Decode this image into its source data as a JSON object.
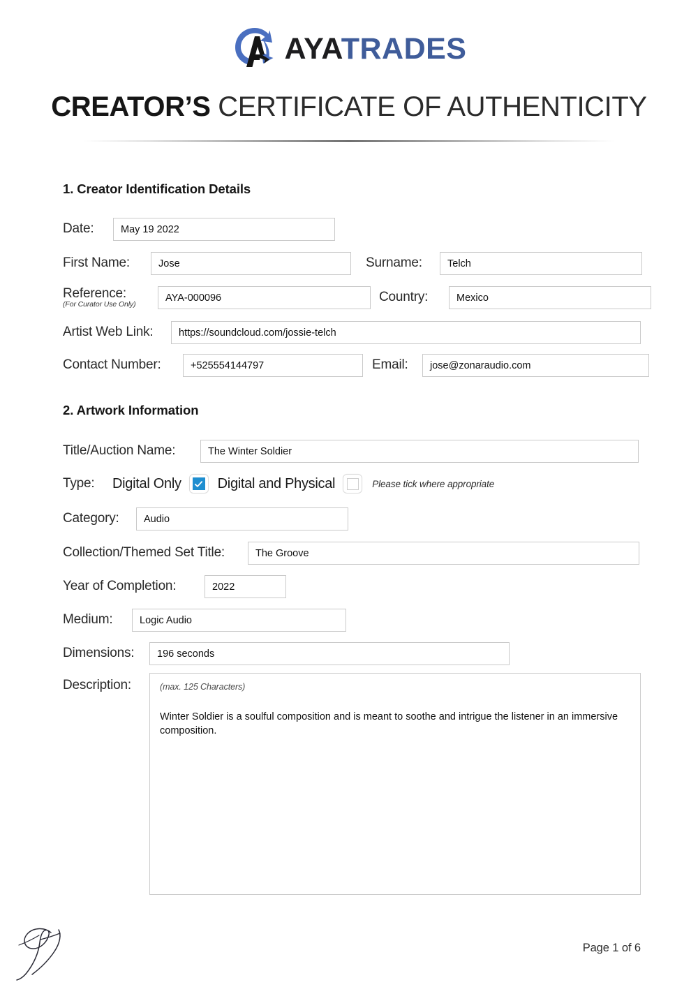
{
  "brand": {
    "logo_icon": "aya-swoosh-arrow-logo",
    "name_part1": "AYA",
    "name_part2": "TRADES",
    "blue": "#3f5c9a",
    "accent_blue": "#1e8ed0"
  },
  "document": {
    "title_strong": "CREATOR’S",
    "title_rest": "CERTIFICATE OF AUTHENTICITY"
  },
  "section1": {
    "heading": "1. Creator Identification Details",
    "date_label": "Date:",
    "date_value": "May 19 2022",
    "first_name_label": "First Name:",
    "first_name_value": "Jose",
    "surname_label": "Surname:",
    "surname_value": "Telch",
    "reference_label": "Reference:",
    "reference_sub_label": "(For Curator Use Only)",
    "reference_value": "AYA-000096",
    "country_label": "Country:",
    "country_value": "Mexico",
    "web_link_label": "Artist Web Link:",
    "web_link_value": "https://soundcloud.com/jossie-telch",
    "contact_label": "Contact Number:",
    "contact_value": "+525554144797",
    "email_label": "Email:",
    "email_value": "jose@zonaraudio.com"
  },
  "section2": {
    "heading": "2. Artwork Information",
    "title_label": "Title/Auction Name:",
    "title_value": "The Winter Soldier",
    "type_label": "Type:",
    "type_option_1": "Digital Only",
    "type_option_1_checked": true,
    "type_option_2": "Digital and Physical",
    "type_option_2_checked": false,
    "type_note": "Please tick where appropriate",
    "category_label": "Category:",
    "category_value": "Audio",
    "collection_label": "Collection/Themed Set Title:",
    "collection_value": "The Groove",
    "year_label": "Year of Completion:",
    "year_value": "2022",
    "medium_label": "Medium:",
    "medium_value": "Logic Audio",
    "dimensions_label": "Dimensions:",
    "dimensions_value": "196 seconds",
    "description_label": "Description:",
    "description_hint": "(max. 125 Characters)",
    "description_value": "Winter Soldier is a soulful composition and is meant to soothe and intrigue the listener in an immersive composition."
  },
  "footer": {
    "signature_icon": "handwritten-signature",
    "page_label": "Page 1 of 6"
  }
}
